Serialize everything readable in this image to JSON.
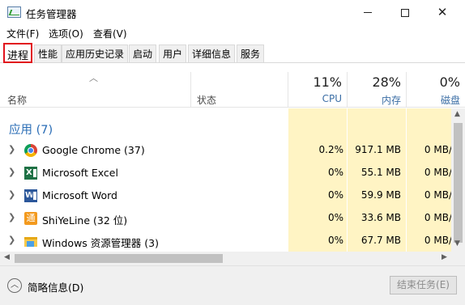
{
  "window": {
    "title": "任务管理器",
    "close_glyph": "✕"
  },
  "menu": [
    "文件(F)",
    "选项(O)",
    "查看(V)"
  ],
  "tabs": [
    "进程",
    "性能",
    "应用历史记录",
    "启动",
    "用户",
    "详细信息",
    "服务"
  ],
  "active_tab": "进程",
  "columns": {
    "name": "名称",
    "status": "状态",
    "cpu": {
      "percent": "11%",
      "label": "CPU"
    },
    "memory": {
      "percent": "28%",
      "label": "内存"
    },
    "disk": {
      "percent": "0%",
      "label": "磁盘"
    }
  },
  "group": {
    "title": "应用 (7)"
  },
  "processes": [
    {
      "name": "Google Chrome (37)",
      "cpu": "0.2%",
      "memory": "917.1 MB",
      "disk": "0 MB/",
      "icon": "chrome-icon"
    },
    {
      "name": "Microsoft Excel",
      "cpu": "0%",
      "memory": "55.1 MB",
      "disk": "0 MB/",
      "icon": "excel-icon"
    },
    {
      "name": "Microsoft Word",
      "cpu": "0%",
      "memory": "59.9 MB",
      "disk": "0 MB/",
      "icon": "word-icon"
    },
    {
      "name": "ShiYeLine (32 位)",
      "cpu": "0%",
      "memory": "33.6 MB",
      "disk": "0 MB/",
      "icon": "shiyeline-icon"
    },
    {
      "name": "Windows 资源管理器 (3)",
      "cpu": "0%",
      "memory": "67.7 MB",
      "disk": "0 MB/",
      "icon": "explorer-icon"
    }
  ],
  "footer": {
    "details_label": "简略信息(D)",
    "end_task_label": "结束任务(E)"
  },
  "icons": {
    "excel_letter": "X",
    "word_letter": "W",
    "shiyeline_glyph": "通"
  },
  "colors": {
    "heat_column": "#fff4c4",
    "group_title": "#2a6db6",
    "column_label": "#3b6ea5",
    "active_tab_border": "#e1131d"
  }
}
